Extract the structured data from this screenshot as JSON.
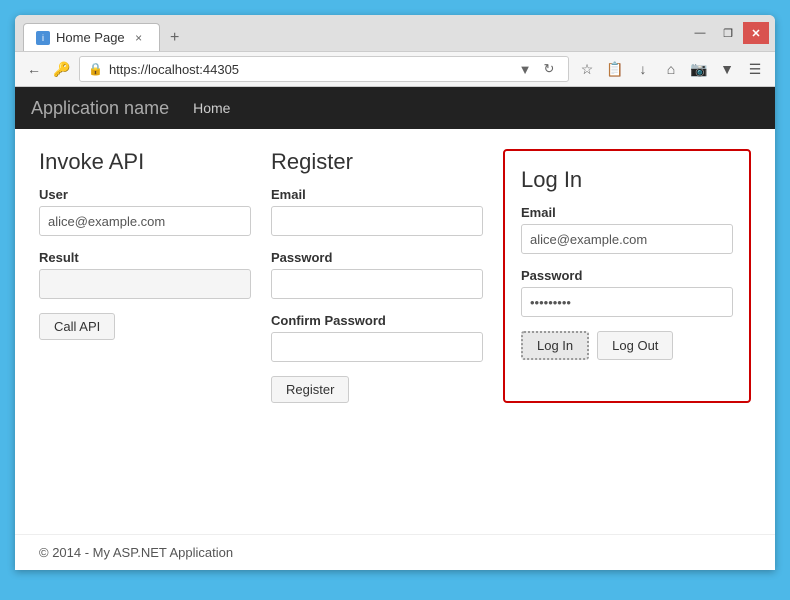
{
  "browser": {
    "tab_label": "Home Page",
    "tab_close": "×",
    "new_tab": "+",
    "url": "https://localhost:44305",
    "win_minimize": "—",
    "win_restore": "❐",
    "win_close": "✕"
  },
  "navbar": {
    "app_name": "Application name",
    "nav_links": [
      "Home"
    ]
  },
  "invoke_api": {
    "title": "Invoke API",
    "user_label": "User",
    "user_value": "alice@example.com",
    "result_label": "Result",
    "result_value": "",
    "call_button": "Call API"
  },
  "register": {
    "title": "Register",
    "email_label": "Email",
    "email_value": "",
    "password_label": "Password",
    "password_value": "",
    "confirm_label": "Confirm Password",
    "confirm_value": "",
    "register_button": "Register"
  },
  "login": {
    "title": "Log In",
    "email_label": "Email",
    "email_value": "alice@example.com",
    "password_label": "Password",
    "password_value": "••••••••",
    "login_button": "Log In",
    "logout_button": "Log Out"
  },
  "footer": {
    "text": "© 2014 - My ASP.NET Application"
  }
}
